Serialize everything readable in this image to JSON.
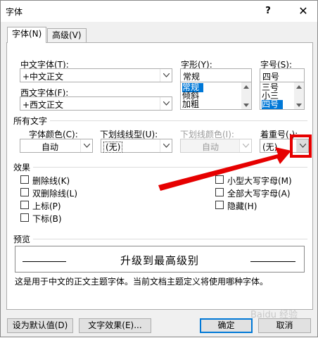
{
  "window": {
    "title": "字体",
    "help": "?",
    "close": "✕"
  },
  "tabs": [
    {
      "label": "字体(N)"
    },
    {
      "label": "高级(V)"
    }
  ],
  "chinese_font": {
    "label": "中文字体(T):",
    "value": "+中文正文"
  },
  "western_font": {
    "label": "西文字体(F):",
    "value": "+西文正文"
  },
  "font_style": {
    "label": "字形(Y):",
    "value": "常规",
    "options": [
      "常规",
      "倾斜",
      "加粗"
    ],
    "selected": "常规"
  },
  "font_size": {
    "label": "字号(S):",
    "value": "四号",
    "options": [
      "三号",
      "小三",
      "四号"
    ],
    "selected": "四号"
  },
  "all_text": {
    "section": "所有文字",
    "font_color": {
      "label": "字体颜色(C):",
      "value": "自动"
    },
    "underline_style": {
      "label": "下划线线型(U):",
      "value": "(无)"
    },
    "underline_color": {
      "label": "下划线颜色(I):",
      "value": "自动"
    },
    "emphasis_mark": {
      "label": "着重号(·):",
      "value": "(无)"
    }
  },
  "effects": {
    "section": "效果",
    "left": [
      "删除线(K)",
      "双删除线(L)",
      "上标(P)",
      "下标(B)"
    ],
    "right": [
      "小型大写字母(M)",
      "全部大写字母(A)",
      "隐藏(H)"
    ]
  },
  "preview": {
    "section": "预览",
    "sample": "升级到最高级别",
    "note": "这是用于中文的正文主题字体。当前文档主题定义将使用哪种字体。"
  },
  "buttons": {
    "set_default": "设为默认值(D)",
    "text_effects": "文字效果(E)...",
    "ok": "确定",
    "cancel": "取消"
  },
  "colors": {
    "accent": "#0078d7",
    "highlight_red": "#e60000"
  },
  "watermark": "Baidu 经验"
}
